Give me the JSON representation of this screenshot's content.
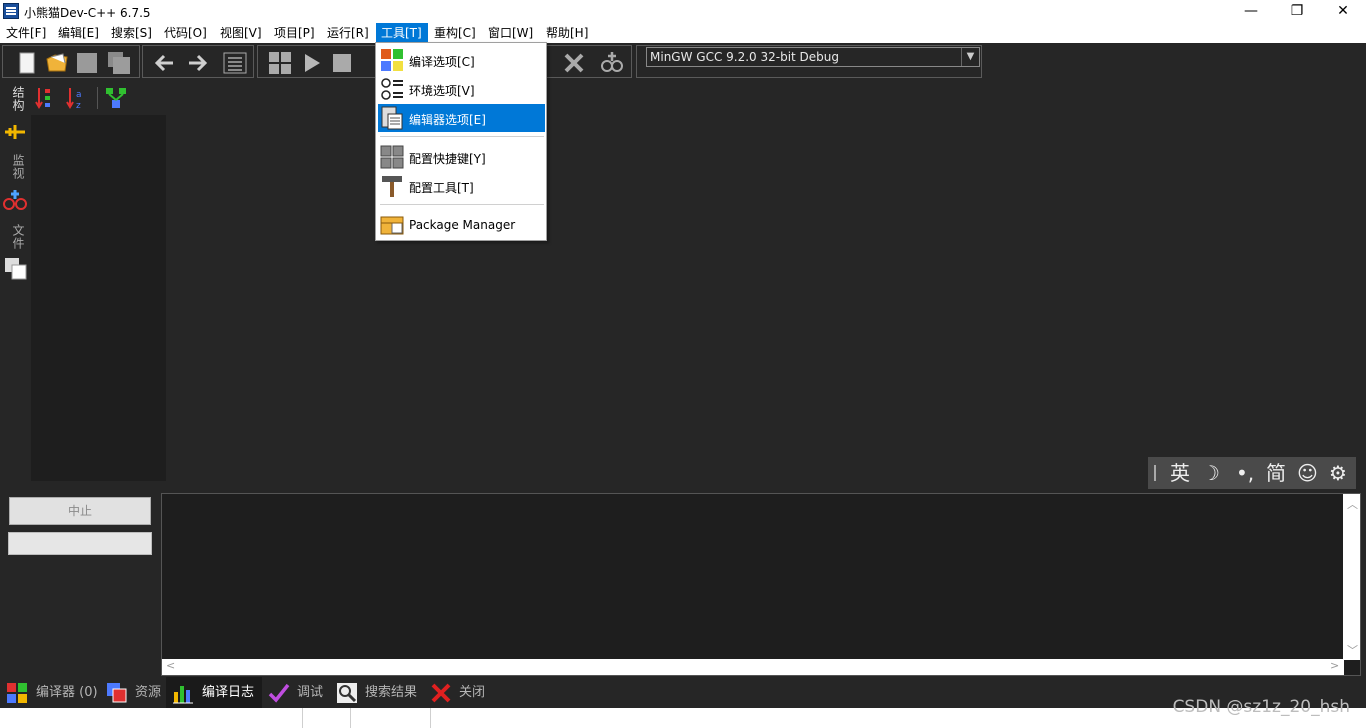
{
  "window": {
    "title": "小熊猫Dev-C++ 6.7.5",
    "minimize_glyph": "—",
    "restore_glyph": "❐",
    "close_glyph": "✕"
  },
  "menubar": {
    "items": [
      {
        "label": "文件[F]"
      },
      {
        "label": "编辑[E]"
      },
      {
        "label": "搜索[S]"
      },
      {
        "label": "代码[O]"
      },
      {
        "label": "视图[V]"
      },
      {
        "label": "项目[P]"
      },
      {
        "label": "运行[R]"
      },
      {
        "label": "工具[T]"
      },
      {
        "label": "重构[C]"
      },
      {
        "label": "窗口[W]"
      },
      {
        "label": "帮助[H]"
      }
    ],
    "active": "工具[T]"
  },
  "tools_menu": {
    "items": [
      {
        "label": "编译选项[C]",
        "icon": "compiler-options-icon"
      },
      {
        "label": "环境选项[V]",
        "icon": "environment-options-icon"
      },
      {
        "label": "编辑器选项[E]",
        "icon": "editor-options-icon",
        "highlighted": true
      },
      {
        "label": "配置快捷键[Y]",
        "icon": "shortcut-config-icon"
      },
      {
        "label": "配置工具[T]",
        "icon": "hammer-icon"
      },
      {
        "label": "Package Manager",
        "icon": "package-manager-icon"
      }
    ]
  },
  "toolbar": {
    "compiler_set": "MinGW GCC 9.2.0 32-bit Debug"
  },
  "left_panel": {
    "tabs": [
      {
        "label": "结构"
      },
      {
        "label": "监视"
      },
      {
        "label": "文件"
      }
    ]
  },
  "ime_bar": {
    "lang": "英",
    "moon": "☽",
    "punct": "•,",
    "script": "简",
    "emoji": "☺",
    "settings": "⚙"
  },
  "compile_panel": {
    "stop_label": "中止"
  },
  "bottom_tabs": [
    {
      "label": "编译器 (0)",
      "icon": "compiler-grid-icon"
    },
    {
      "label": "资源",
      "icon": "resource-icon"
    },
    {
      "label": "编译日志",
      "icon": "bar-chart-icon",
      "active": true
    },
    {
      "label": "调试",
      "icon": "checkmark-icon"
    },
    {
      "label": "搜索结果",
      "icon": "search-result-icon"
    },
    {
      "label": "关闭",
      "icon": "close-x-icon"
    }
  ],
  "watermark": "CSDN @sz1z_20_hsh",
  "colors": {
    "accent": "#0078d7",
    "background": "#262626"
  }
}
